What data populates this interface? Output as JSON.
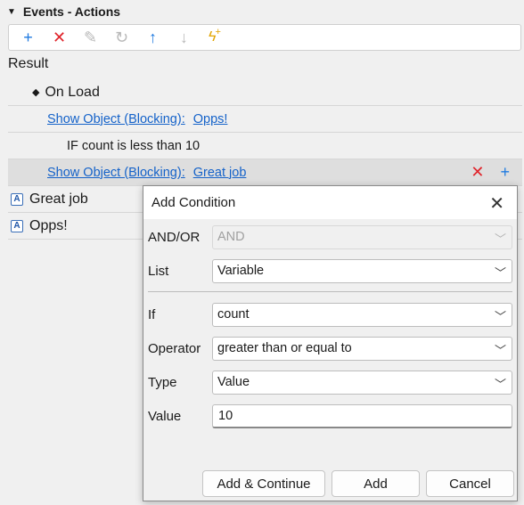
{
  "panel": {
    "title": "Events - Actions"
  },
  "toolbar": {
    "add": "+",
    "delete": "✕",
    "edit": "✎",
    "refresh": "↻",
    "move_up": "↑",
    "move_down": "↓",
    "trigger": "ϟ",
    "trigger_plus": "+"
  },
  "tree": {
    "result_label": "Result",
    "event": "On Load",
    "actions": [
      {
        "type": "Show Object (Blocking):",
        "target": "Opps!"
      },
      {
        "condition": "IF count is less than 10"
      },
      {
        "type": "Show Object (Blocking):",
        "target": "Great job"
      }
    ],
    "objects": [
      "Great job",
      "Opps!"
    ]
  },
  "dialog": {
    "title": "Add Condition",
    "andor_label": "AND/OR",
    "andor_value": "AND",
    "list_label": "List",
    "list_value": "Variable",
    "if_label": "If",
    "if_value": "count",
    "operator_label": "Operator",
    "operator_value": "greater than or equal to",
    "type_label": "Type",
    "type_value": "Value",
    "value_label": "Value",
    "value_value": "10",
    "btn_add_continue": "Add & Continue",
    "btn_add": "Add",
    "btn_cancel": "Cancel"
  }
}
